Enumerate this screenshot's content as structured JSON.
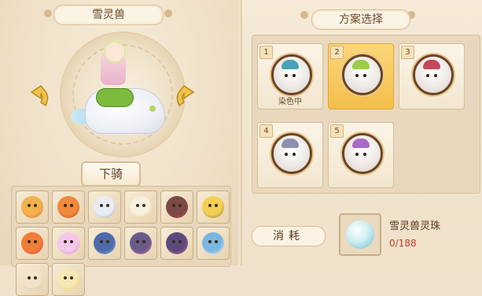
{
  "left_panel": {
    "title": "雪灵兽",
    "action_label": "下骑",
    "mounts": [
      {
        "color": "#f3b24b",
        "accent": "#e4572e"
      },
      {
        "color": "#f08a3c",
        "accent": "#c43a22"
      },
      {
        "color": "#e9ecf2",
        "accent": "#8f97a8"
      },
      {
        "color": "#f6f0df",
        "accent": "#e7b94d"
      },
      {
        "color": "#7a4a46",
        "accent": "#d13d3d"
      },
      {
        "color": "#f4cf55",
        "accent": "#8a6a2a"
      },
      {
        "color": "#f07d3a",
        "accent": "#d9452c"
      },
      {
        "color": "#f5c7e8",
        "accent": "#c48ad6"
      },
      {
        "color": "#4e6aa8",
        "accent": "#9fc3ec"
      },
      {
        "color": "#6a5a8a",
        "accent": "#e67aa0"
      },
      {
        "color": "#5d4a7d",
        "accent": "#e56fa0"
      },
      {
        "color": "#7bb6e3",
        "accent": "#ffffff"
      },
      {
        "color": "#f1e4ca",
        "accent": "#d6b985"
      },
      {
        "color": "#f6e8b4",
        "accent": "#e6c34a"
      }
    ]
  },
  "right_panel": {
    "title": "方案选择",
    "schemes": [
      {
        "number": "1",
        "tag": "染色中",
        "hat": "#4aa3b5",
        "selected": false
      },
      {
        "number": "2",
        "tag": "",
        "hat": "#9ccd46",
        "selected": true
      },
      {
        "number": "3",
        "tag": "",
        "hat": "#c7485a",
        "selected": false
      },
      {
        "number": "4",
        "tag": "",
        "hat": "#8f8fb0",
        "selected": false
      },
      {
        "number": "5",
        "tag": "",
        "hat": "#a96ac9",
        "selected": false
      }
    ],
    "consume_label": "消耗",
    "item": {
      "name": "雪灵兽灵珠",
      "count": "0/188"
    }
  },
  "colors": {
    "accent": "#f4bf4b",
    "count_red": "#c23b2e",
    "text_brown": "#5b3b22"
  }
}
